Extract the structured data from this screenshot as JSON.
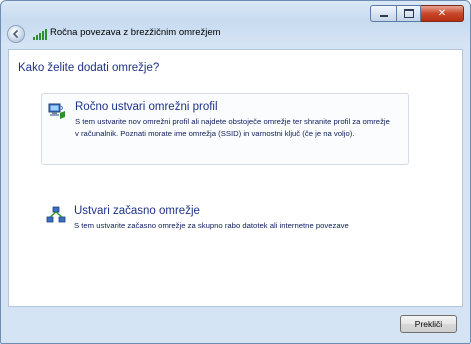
{
  "window": {
    "title": "Ročna povezava z brezžičnim omrežjem"
  },
  "main": {
    "heading": "Kako želite dodati omrežje?",
    "options": [
      {
        "title": "Ročno ustvari omrežni profil",
        "description": "S tem ustvarite nov omrežni profil ali najdete obstoječe omrežje ter shranite profil za omrežje v računalnik. Poznati morate ime omrežja (SSID) in varnostni ključ (če je na voljo).",
        "icon": "network-pc-icon"
      },
      {
        "title": "Ustvari začasno omrežje",
        "description": "S tem ustvarite začasno omrežje za skupno rabo datotek ali internetne povezave",
        "icon": "adhoc-network-icon"
      }
    ]
  },
  "footer": {
    "cancel_label": "Prekliči"
  },
  "colors": {
    "link_blue": "#1e3287",
    "close_red": "#c7482b"
  }
}
